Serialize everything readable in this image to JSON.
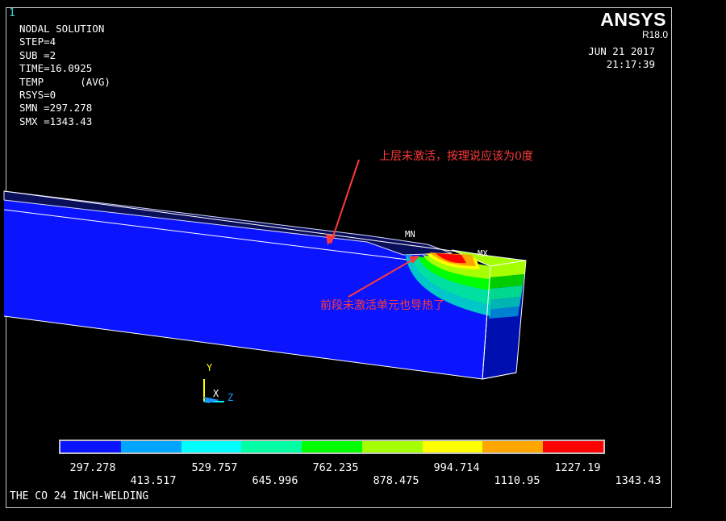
{
  "window": {
    "number": "1"
  },
  "info": {
    "line1": "NODAL SOLUTION",
    "line2": "STEP=4",
    "line3": "SUB =2",
    "line4": "TIME=16.0925",
    "line5": "TEMP      (AVG)",
    "line6": "RSYS=0",
    "line7": "SMN =297.278",
    "line8": "SMX =1343.43"
  },
  "brand": {
    "name": "ANSYS",
    "version": "R18.0"
  },
  "timestamp": {
    "date": "JUN 21 2017",
    "time": "21:17:39"
  },
  "markers": {
    "min": "MN",
    "max": "MX"
  },
  "axes": {
    "y": "Y",
    "x": "X",
    "z": "Z"
  },
  "annotations": {
    "top": "上层未激活，按理说应该为0度",
    "bottom": "前段未激活单元也导热了"
  },
  "legend": {
    "colors": [
      "#0a14ff",
      "#00a5ff",
      "#00ffff",
      "#00ffa5",
      "#00ff00",
      "#a5ff00",
      "#ffff00",
      "#ffa500",
      "#ff0000"
    ],
    "values_upper": [
      "297.278",
      "529.757",
      "762.235",
      "994.714",
      "1227.19"
    ],
    "values_lower": [
      "413.517",
      "645.996",
      "878.475",
      "1110.95",
      "1343.43"
    ]
  },
  "footer_title": "THE CO 24 INCH-WELDING",
  "colors": {
    "body": "#0a14ff",
    "annotation": "#ff3a3a",
    "window_number": "#38d0d0"
  }
}
